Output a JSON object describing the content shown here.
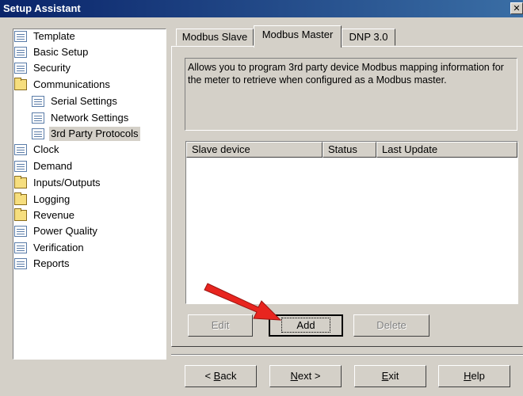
{
  "window": {
    "title": "Setup Assistant",
    "close_glyph": "✕"
  },
  "tree": {
    "items": [
      {
        "label": "Template",
        "icon": "page-icon"
      },
      {
        "label": "Basic Setup",
        "icon": "page-icon"
      },
      {
        "label": "Security",
        "icon": "page-icon"
      },
      {
        "label": "Communications",
        "icon": "folder-icon"
      },
      {
        "label": "Serial Settings",
        "icon": "page-icon"
      },
      {
        "label": "Network Settings",
        "icon": "page-icon"
      },
      {
        "label": "3rd Party Protocols",
        "icon": "page-icon",
        "selected": true
      },
      {
        "label": "Clock",
        "icon": "page-icon"
      },
      {
        "label": "Demand",
        "icon": "page-icon"
      },
      {
        "label": "Inputs/Outputs",
        "icon": "folder-icon"
      },
      {
        "label": "Logging",
        "icon": "folder-icon"
      },
      {
        "label": "Revenue",
        "icon": "folder-icon"
      },
      {
        "label": "Power Quality",
        "icon": "page-icon"
      },
      {
        "label": "Verification",
        "icon": "page-icon"
      },
      {
        "label": "Reports",
        "icon": "page-icon"
      }
    ]
  },
  "tabs": [
    {
      "label": "Modbus Slave"
    },
    {
      "label": "Modbus Master",
      "active": true
    },
    {
      "label": "DNP 3.0"
    }
  ],
  "description": "Allows you to program 3rd party device Modbus mapping information for the meter to retrieve when configured as a Modbus master.",
  "list": {
    "columns": [
      "Slave device",
      "Status",
      "Last Update"
    ],
    "rows": []
  },
  "list_buttons": {
    "edit": "Edit",
    "add": "Add",
    "delete": "Delete"
  },
  "footer": {
    "back_prefix": "< ",
    "back_key": "B",
    "back_rest": "ack",
    "next_key": "N",
    "next_rest": "ext >",
    "exit_key": "E",
    "exit_rest": "xit",
    "help_key": "H",
    "help_rest": "elp"
  },
  "annotation": {
    "arrow_color": "#e8251f"
  },
  "colors": {
    "title_bar": "#0a246a",
    "face": "#d4d0c8"
  }
}
